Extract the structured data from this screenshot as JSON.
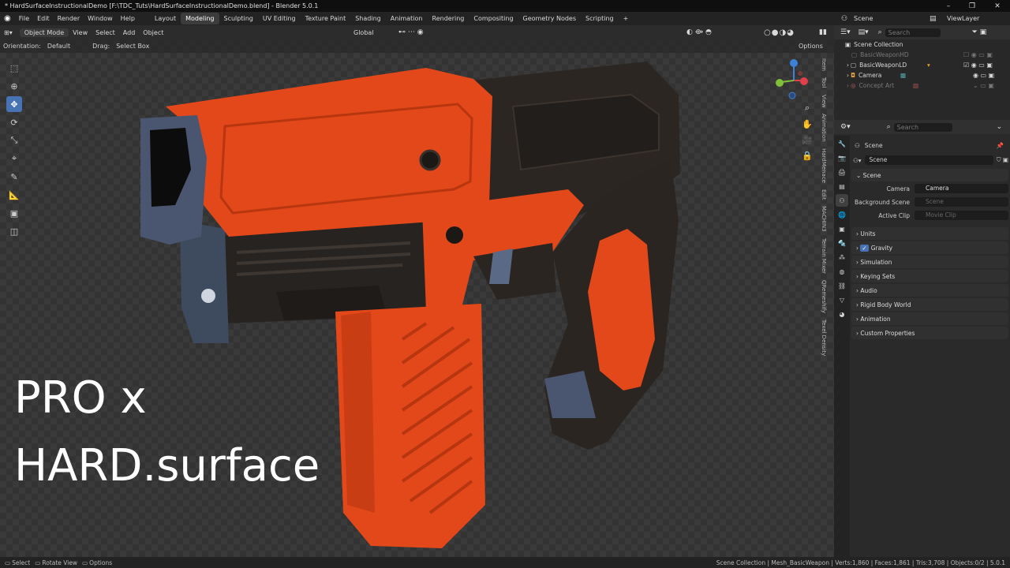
{
  "app": {
    "title": "* HardSurfaceInstructionalDemo [F:\\TDC_Tuts\\HardSurfaceInstructionalDemo.blend] - Blender 5.0.1",
    "window_controls": [
      "–",
      "❐",
      "✕"
    ]
  },
  "menu": {
    "items": [
      "File",
      "Edit",
      "Render",
      "Window",
      "Help"
    ],
    "workspaces": [
      "Layout",
      "Modeling",
      "Sculpting",
      "UV Editing",
      "Texture Paint",
      "Shading",
      "Animation",
      "Rendering",
      "Compositing",
      "Geometry Nodes",
      "Scripting"
    ],
    "active_workspace": "Modeling",
    "add_tab": "+",
    "scene": "Scene",
    "view_layer": "ViewLayer"
  },
  "viewport_header": {
    "mode": "Object Mode",
    "menus": [
      "View",
      "Select",
      "Add",
      "Object"
    ],
    "transform": "Global",
    "orientation_label": "Orientation:",
    "orientation_value": "Default",
    "drag_label": "Drag:",
    "drag_value": "Select Box",
    "options": "Options"
  },
  "overlay": {
    "line1": "PRO x",
    "line2": "HARD.surface"
  },
  "side_tabs": [
    "Item",
    "Tool",
    "View",
    "Animation",
    "HardMenace",
    "Edit",
    "MACHIN3",
    "Terrain Mixer",
    "QRemeshify",
    "Texel Density"
  ],
  "outliner": {
    "search_placeholder": "Search",
    "root": "Scene Collection",
    "items": [
      {
        "name": "BasicWeaponHD",
        "dim": true
      },
      {
        "name": "BasicWeaponLD",
        "dim": false
      },
      {
        "name": "Camera",
        "dim": false
      },
      {
        "name": "Concept Art",
        "dim": true
      }
    ]
  },
  "properties": {
    "search_placeholder": "Search",
    "breadcrumb": "Scene",
    "scene_name": "Scene",
    "section_scene": "Scene",
    "camera_label": "Camera",
    "camera_value": "Camera",
    "bg_scene_label": "Background Scene",
    "bg_scene_placeholder": "Scene",
    "active_clip_label": "Active Clip",
    "active_clip_placeholder": "Movie Clip",
    "sections": [
      "Units",
      "Gravity",
      "Simulation",
      "Keying Sets",
      "Audio",
      "Rigid Body World",
      "Animation",
      "Custom Properties"
    ]
  },
  "statusbar": {
    "select": "Select",
    "rotate": "Rotate View",
    "options": "Options",
    "info": "Scene Collection | Mesh_BasicWeapon | Verts:1,860 | Faces:1,861 | Tris:3,708 | Objects:0/2 | 5.0.1"
  },
  "colors": {
    "accent": "#4772b3",
    "orange": "#e2481a",
    "dark": "#2b2622",
    "gizmo_x": "#e0404a",
    "gizmo_y": "#7fbf3a",
    "gizmo_z": "#3b82d8"
  }
}
